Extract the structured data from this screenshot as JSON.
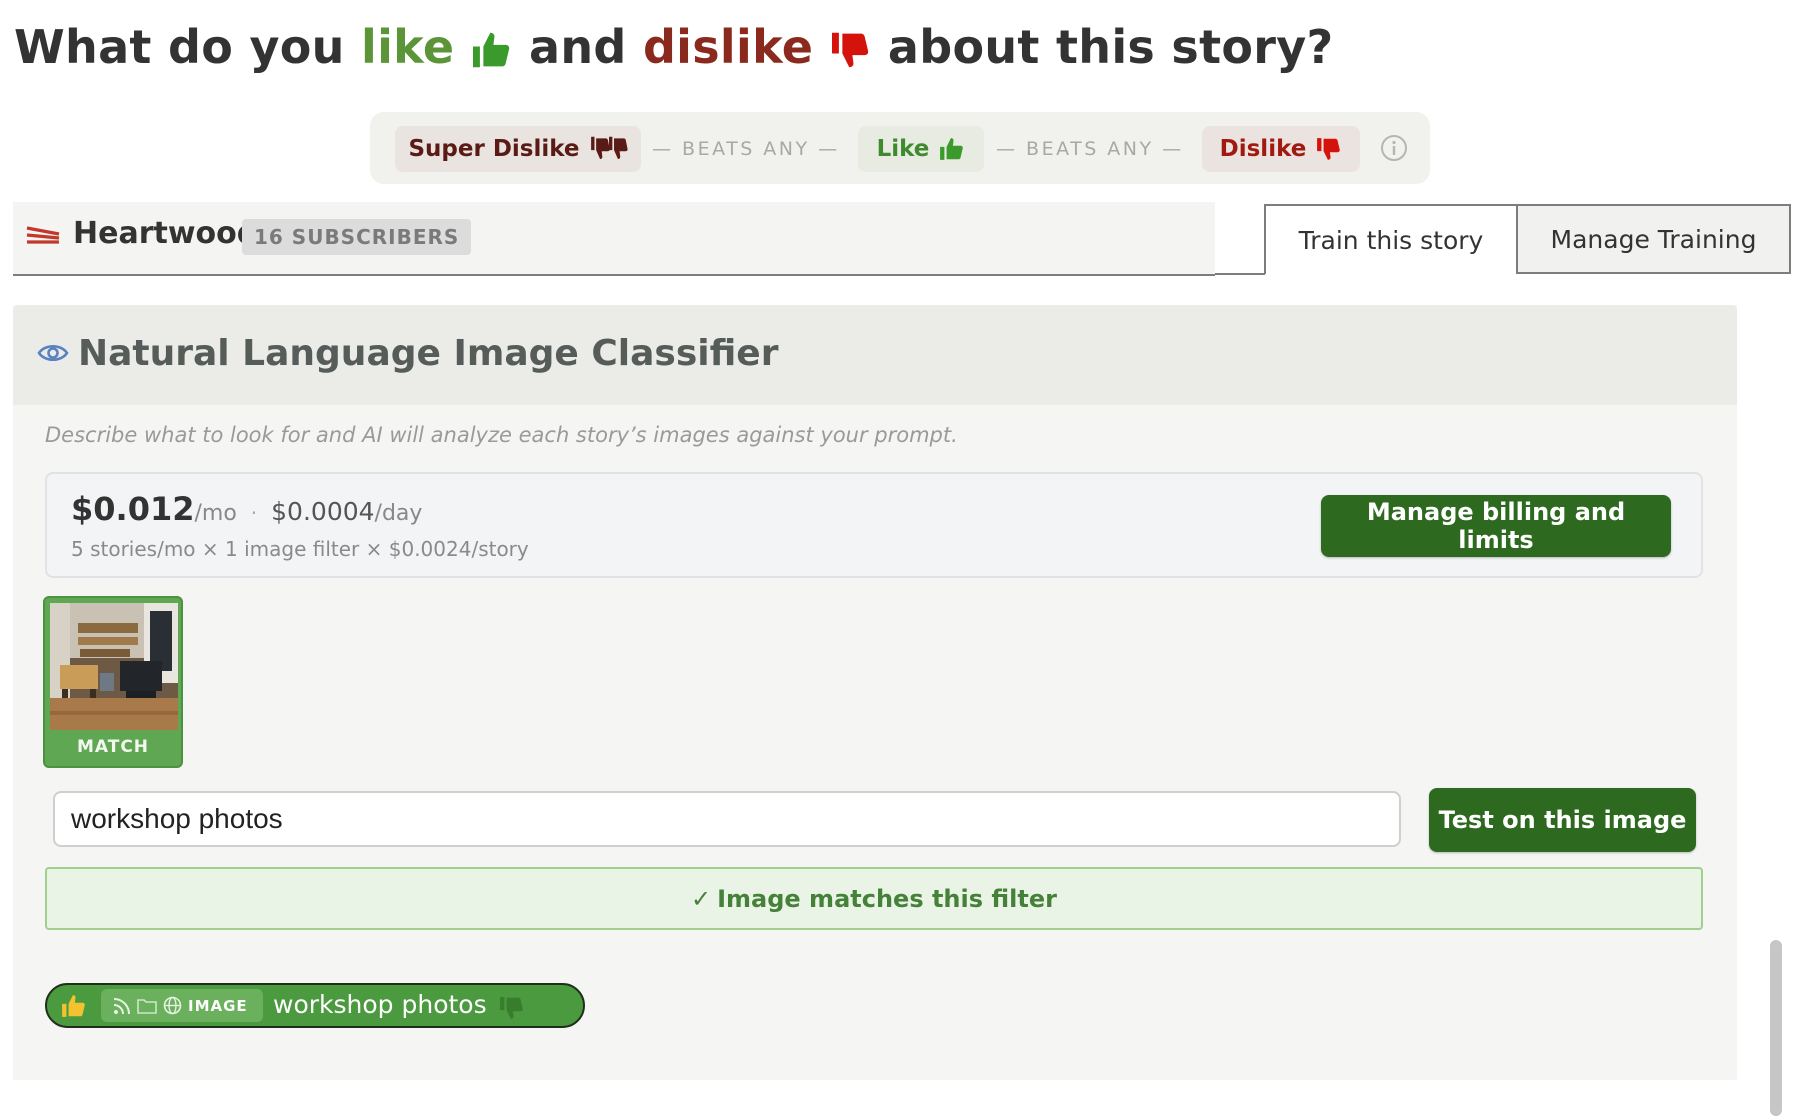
{
  "heading": {
    "prefix": "What do you",
    "like": "like",
    "middle": "and",
    "dislike": "dislike",
    "suffix": "about this story?"
  },
  "legend": {
    "super_dislike": "Super Dislike",
    "beats_any_1": "— BEATS ANY —",
    "like": "Like",
    "beats_any_2": "— BEATS ANY —",
    "dislike": "Dislike"
  },
  "feed": {
    "title": "Heartwood",
    "subscribers": "16 SUBSCRIBERS"
  },
  "tabs": {
    "train": "Train this story",
    "manage": "Manage Training"
  },
  "classifier": {
    "title": "Natural Language Image Classifier",
    "description": "Describe what to look for and AI will analyze each story’s images against your prompt."
  },
  "billing": {
    "monthly": "$0.012",
    "monthly_unit": "/mo",
    "separator": "·",
    "daily": "$0.0004",
    "daily_unit": "/day",
    "detail": "5 stories/mo × 1 image filter × $0.0024/story",
    "button": "Manage billing and limits"
  },
  "thumbnail": {
    "label": "MATCH"
  },
  "prompt": {
    "value": "workshop photos",
    "test_button": "Test on this image"
  },
  "result": {
    "check": "✓",
    "message": "Image matches this filter"
  },
  "chip": {
    "type": "IMAGE",
    "text": "workshop photos"
  },
  "colors": {
    "like": "#5c9438",
    "dislike": "#8a2a1e",
    "button_green": "#2d6a1f",
    "match_green": "#5fa752"
  }
}
